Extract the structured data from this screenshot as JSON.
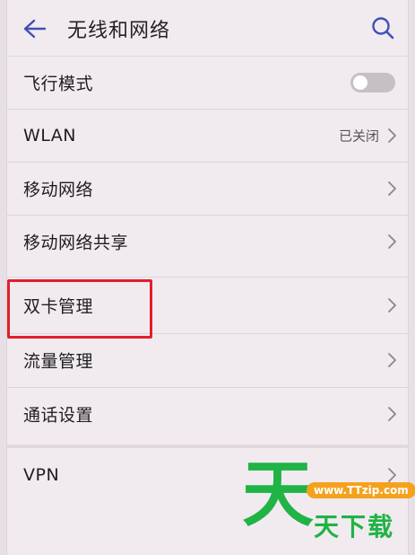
{
  "header": {
    "title": "无线和网络"
  },
  "rows": [
    {
      "label": "飞行模式",
      "toggle": {
        "state": "off"
      }
    },
    {
      "label": "WLAN",
      "status": "已关闭"
    },
    {
      "label": "移动网络"
    },
    {
      "label": "移动网络共享"
    },
    {
      "label": "双卡管理",
      "highlighted": true
    },
    {
      "label": "流量管理"
    },
    {
      "label": "通话设置"
    },
    {
      "label": "VPN"
    }
  ],
  "watermark": {
    "glyph": "天",
    "url": "www.TTzip.com",
    "text": "天下载"
  },
  "colors": {
    "highlight": "#e11f2a",
    "watermark_green": "#20b345",
    "watermark_orange": "#f4a21d",
    "accent": "#3f51b5"
  }
}
